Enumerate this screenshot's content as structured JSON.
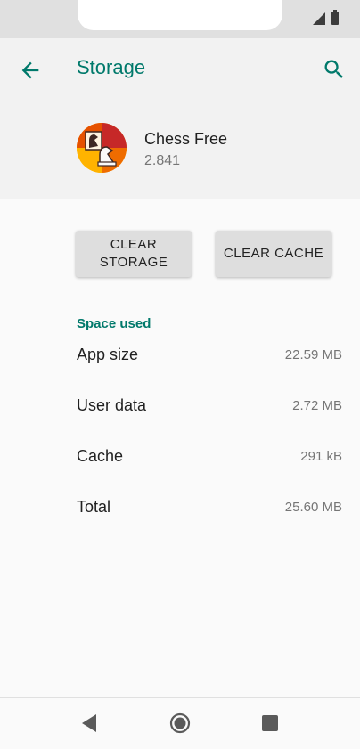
{
  "header": {
    "title": "Storage",
    "back_icon": "arrow-back-icon",
    "search_icon": "search-icon",
    "accent_color": "#00796b"
  },
  "app": {
    "name": "Chess Free",
    "version": "2.841",
    "icon": "chess-knight-icon"
  },
  "actions": {
    "clear_storage_label": "CLEAR STORAGE",
    "clear_cache_label": "CLEAR CACHE"
  },
  "space_used": {
    "title": "Space used",
    "rows": [
      {
        "label": "App size",
        "value": "22.59 MB"
      },
      {
        "label": "User data",
        "value": "2.72 MB"
      },
      {
        "label": "Cache",
        "value": "291 kB"
      },
      {
        "label": "Total",
        "value": "25.60 MB"
      }
    ]
  },
  "nav_bar": {
    "back_icon": "nav-back-triangle-icon",
    "home_icon": "nav-home-circle-icon",
    "recents_icon": "nav-recents-square-icon"
  }
}
